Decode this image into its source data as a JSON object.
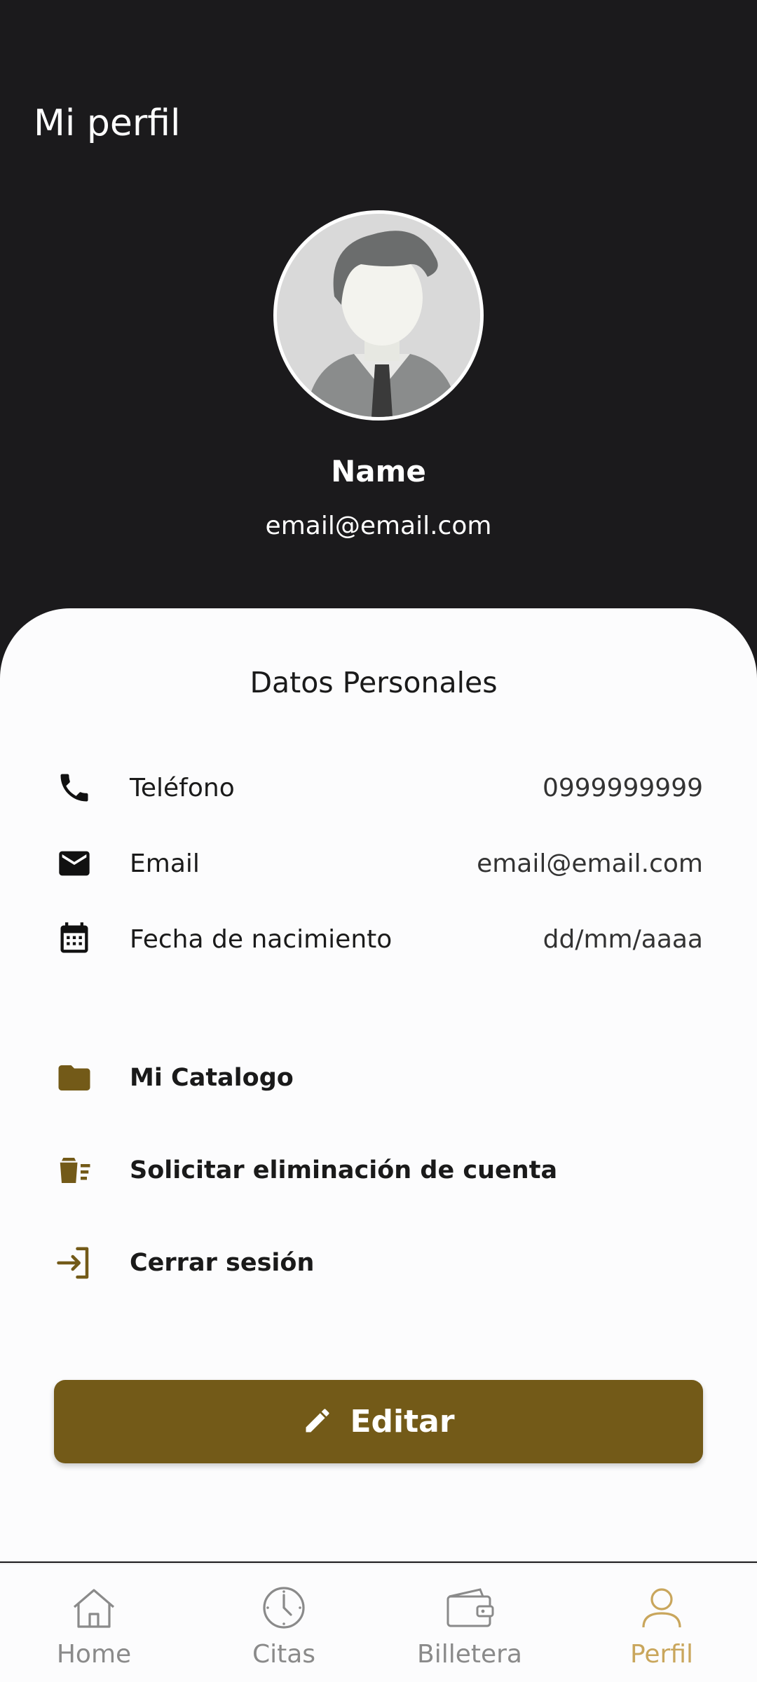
{
  "header": {
    "title": "Mi perfil",
    "user_name": "Name",
    "user_email": "email@email.com"
  },
  "personal": {
    "section_title": "Datos Personales",
    "rows": [
      {
        "label": "Teléfono",
        "value": "0999999999",
        "icon": "phone-icon"
      },
      {
        "label": "Email",
        "value": "email@email.com",
        "icon": "mail-icon"
      },
      {
        "label": "Fecha de nacimiento",
        "value": "dd/mm/aaaa",
        "icon": "calendar-icon"
      }
    ]
  },
  "actions": [
    {
      "label": "Mi Catalogo",
      "icon": "folder-icon"
    },
    {
      "label": "Solicitar eliminación de cuenta",
      "icon": "trash-icon"
    },
    {
      "label": "Cerrar sesión",
      "icon": "logout-icon"
    }
  ],
  "edit_button": {
    "label": "Editar",
    "icon": "pencil-icon"
  },
  "bottom_nav": [
    {
      "label": "Home",
      "icon": "home-icon",
      "active": false
    },
    {
      "label": "Citas",
      "icon": "clock-icon",
      "active": false
    },
    {
      "label": "Billetera",
      "icon": "wallet-icon",
      "active": false
    },
    {
      "label": "Perfil",
      "icon": "user-icon",
      "active": true
    }
  ],
  "colors": {
    "header_bg": "#1b1a1c",
    "accent": "#735a18",
    "active_nav": "#c9a65c",
    "inactive_nav": "#8a8a8a"
  }
}
